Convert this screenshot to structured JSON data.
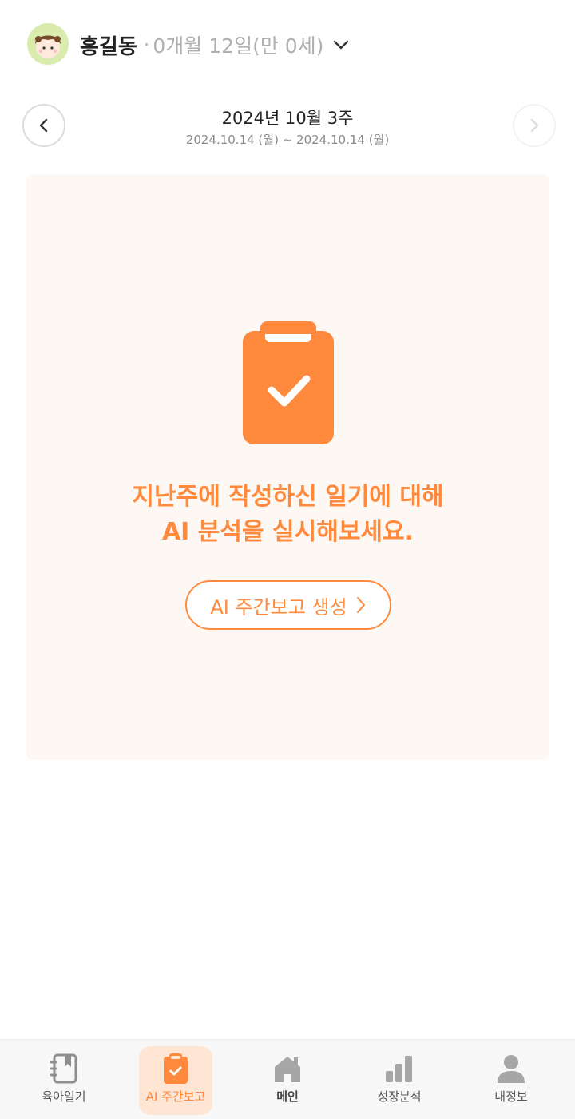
{
  "header": {
    "child_name": "홍길동",
    "separator": "·",
    "age_text": "0개월 12일(만 0세)"
  },
  "week_nav": {
    "title": "2024년 10월 3주",
    "range": "2024.10.14 (월) ~ 2024.10.14 (월)"
  },
  "report_card": {
    "message_line1": "지난주에 작성하신 일기에 대해",
    "message_line2": "AI 분석을 실시해보세요.",
    "generate_button_label": "AI 주간보고 생성"
  },
  "tab_bar": {
    "tabs": [
      {
        "label": "육아일기",
        "icon": "diary-icon",
        "active": false
      },
      {
        "label": "AI 주간보고",
        "icon": "clipboard-check-icon",
        "active": true
      },
      {
        "label": "메인",
        "icon": "home-icon",
        "active": false
      },
      {
        "label": "성장분석",
        "icon": "bar-chart-icon",
        "active": false
      },
      {
        "label": "내정보",
        "icon": "person-icon",
        "active": false
      }
    ]
  },
  "colors": {
    "accent": "#ff8a3d",
    "card_background": "#fdf8f4",
    "active_tab_background": "#ffe6d4",
    "avatar_background": "#d9ecae"
  }
}
